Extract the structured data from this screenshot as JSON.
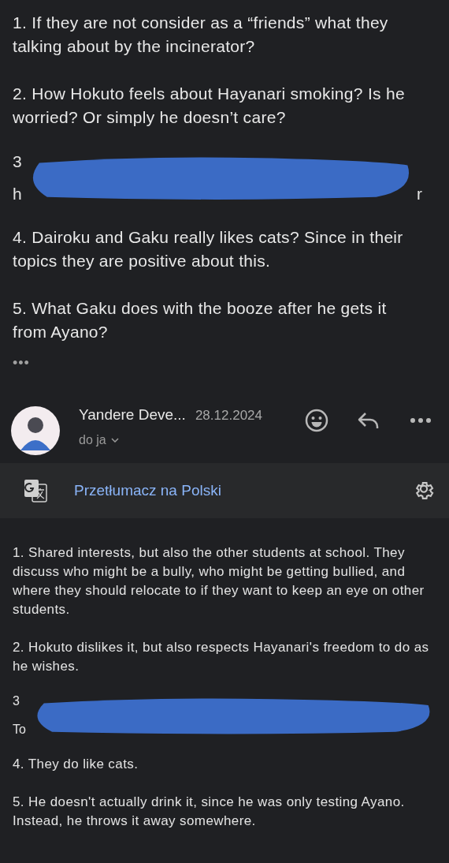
{
  "quoted": [
    {
      "kind": "text",
      "text": "1. If they are not consider as a “friends” what they talking about by the incinerator?"
    },
    {
      "kind": "text",
      "text": "2. How Hokuto feels about Hayanari smoking? Is he worried? Or simply he doesn’t care?"
    },
    {
      "kind": "redacted",
      "fragments": [
        "3",
        "h",
        "r"
      ]
    },
    {
      "kind": "text",
      "text": "4. Dairoku and Gaku really likes cats? Since in their topics they are positive about this."
    },
    {
      "kind": "text",
      "text": "5. What Gaku does with the booze after he gets it from Ayano?"
    }
  ],
  "more_label": "•••",
  "message": {
    "sender": "Yandere Deve...",
    "date": "28.12.2024",
    "recipient": "do ja"
  },
  "translate": {
    "label": "Przetłumacz na Polski"
  },
  "body": [
    {
      "kind": "text",
      "text": "1. Shared interests, but also the other students at school. They discuss who might be a bully, who might be getting bullied, and where they should relocate to if they want to keep an eye on other students."
    },
    {
      "kind": "text",
      "text": "2. Hokuto dislikes it, but also respects Hayanari's freedom to do as he wishes."
    },
    {
      "kind": "redacted",
      "fragments": [
        "3",
        "To"
      ]
    },
    {
      "kind": "text",
      "text": "4. They do like cats."
    },
    {
      "kind": "text",
      "text": "5. He doesn't actually drink it, since he was only testing Ayano. Instead, he throws it away somewhere."
    }
  ]
}
